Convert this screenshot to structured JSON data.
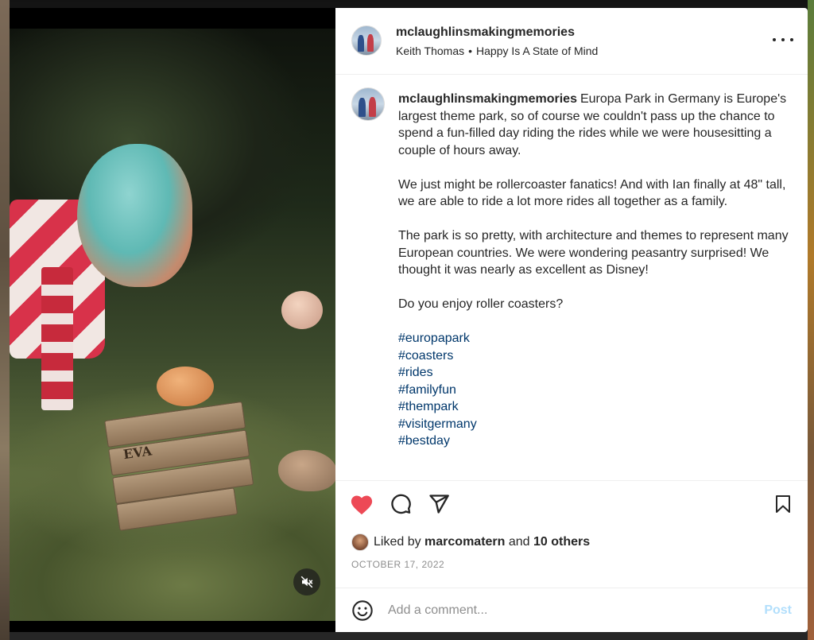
{
  "post": {
    "username": "mclaughlinsmakingmemories",
    "audio_artist": "Keith Thomas",
    "audio_title": "Happy Is A State of Mind",
    "separator": "•",
    "caption": {
      "username": "mclaughlinsmakingmemories",
      "paragraph1": "Europa Park in Germany is Europe's largest theme park, so of course we couldn't pass up the chance to spend a fun-filled day riding the rides while we were housesitting a couple of hours away.",
      "paragraph2": "We just might be rollercoaster fanatics! And with Ian finally at 48\" tall, we are able to ride a lot more rides all together as a family.",
      "paragraph3": "The park is so pretty, with architecture and themes to represent many European countries. We were wondering peasantry surprised! We thought it was nearly as excellent as Disney!",
      "paragraph4": "Do you enjoy roller coasters?",
      "hashtags": [
        "#europapark",
        "#coasters",
        "#rides",
        "#familyfun",
        "#thempark",
        "#visitgermany",
        "#bestday"
      ]
    },
    "likes": {
      "prefix": "Liked by",
      "user": "marcomatern",
      "connector": "and",
      "others": "10 others"
    },
    "date": "OCTOBER 17, 2022",
    "comment": {
      "placeholder": "Add a comment...",
      "post_label": "Post"
    },
    "sign_text": "EVA"
  },
  "icons": {
    "like": "heart-filled-icon",
    "comment": "comment-icon",
    "share": "send-icon",
    "save": "bookmark-icon",
    "emoji": "emoji-icon",
    "more": "more-icon",
    "mute": "volume-muted-icon"
  },
  "colors": {
    "like_red": "#ed4956",
    "hashtag_blue": "#00376b",
    "post_button_disabled": "#b2dffc",
    "text": "#262626",
    "muted": "#8e8e8e"
  }
}
